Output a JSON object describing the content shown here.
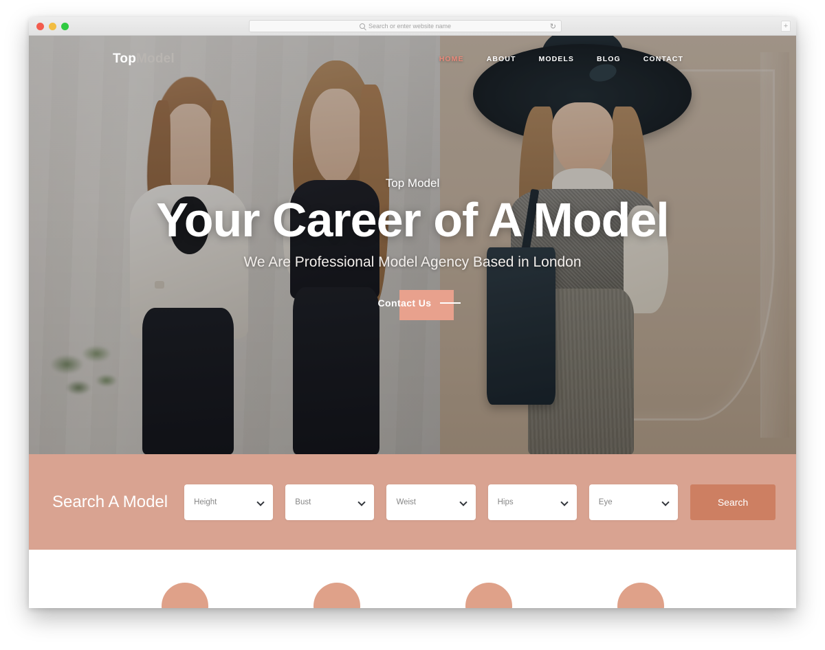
{
  "browser": {
    "traffic_lights": [
      "close",
      "minimize",
      "maximize"
    ],
    "address_placeholder": "Search or enter website name",
    "reload_icon": "reload-icon",
    "search_icon": "search-icon",
    "new_tab_label": "+"
  },
  "site": {
    "logo": {
      "primary": "Top",
      "secondary": "Model"
    },
    "nav": [
      {
        "label": "HOME",
        "active": true
      },
      {
        "label": "ABOUT",
        "active": false
      },
      {
        "label": "MODELS",
        "active": false
      },
      {
        "label": "BLOG",
        "active": false
      },
      {
        "label": "CONTACT",
        "active": false
      }
    ],
    "hero": {
      "kicker": "Top Model",
      "title": "Your Career of A Model",
      "subtitle": "We Are Professional Model Agency Based in London",
      "cta_label": "Contact Us"
    },
    "search_section": {
      "title": "Search A Model",
      "fields": [
        {
          "placeholder": "Height",
          "icon": "chevron-down-icon"
        },
        {
          "placeholder": "Bust",
          "icon": "chevron-down-icon"
        },
        {
          "placeholder": "Weist",
          "icon": "chevron-down-icon"
        },
        {
          "placeholder": "Hips",
          "icon": "chevron-down-icon"
        },
        {
          "placeholder": "Eye",
          "icon": "chevron-down-icon"
        }
      ],
      "button_label": "Search"
    },
    "features": [
      {
        "icon": "feature-circle-icon"
      },
      {
        "icon": "feature-circle-icon"
      },
      {
        "icon": "feature-circle-icon"
      },
      {
        "icon": "feature-circle-icon"
      }
    ]
  },
  "colors": {
    "accent_salmon": "#d9a391",
    "accent_salmon_dark": "#cd7f62",
    "accent_coral": "#e8a18d",
    "nav_active": "#e8897a",
    "white": "#ffffff"
  }
}
